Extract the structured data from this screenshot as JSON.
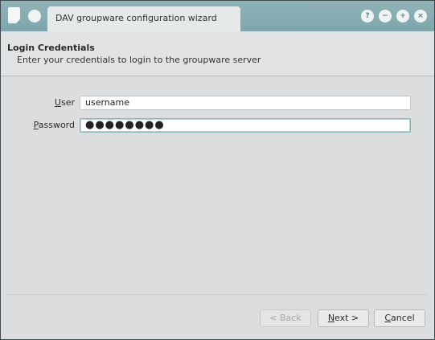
{
  "window": {
    "tab_title": "DAV groupware configuration wizard"
  },
  "titlebar_buttons": [
    {
      "name": "help-icon",
      "glyph": "?"
    },
    {
      "name": "minimize-icon",
      "glyph": "−"
    },
    {
      "name": "maximize-icon",
      "glyph": "+"
    },
    {
      "name": "close-icon",
      "glyph": "×"
    }
  ],
  "page": {
    "title": "Login Credentials",
    "subtitle": "Enter your credentials to login to the groupware server"
  },
  "form": {
    "user_label_accel": "U",
    "user_label_rest": "ser",
    "user_value": "username",
    "password_label_accel": "P",
    "password_label_rest": "assword",
    "password_value": "●●●●●●●●"
  },
  "buttons": {
    "back_label": "< Back",
    "next_accel": "N",
    "next_rest": "ext >",
    "cancel_accel": "C",
    "cancel_rest": "ancel"
  },
  "colors": {
    "titlebar": "#7fa6ab",
    "focus_border": "#8ab2b7"
  }
}
